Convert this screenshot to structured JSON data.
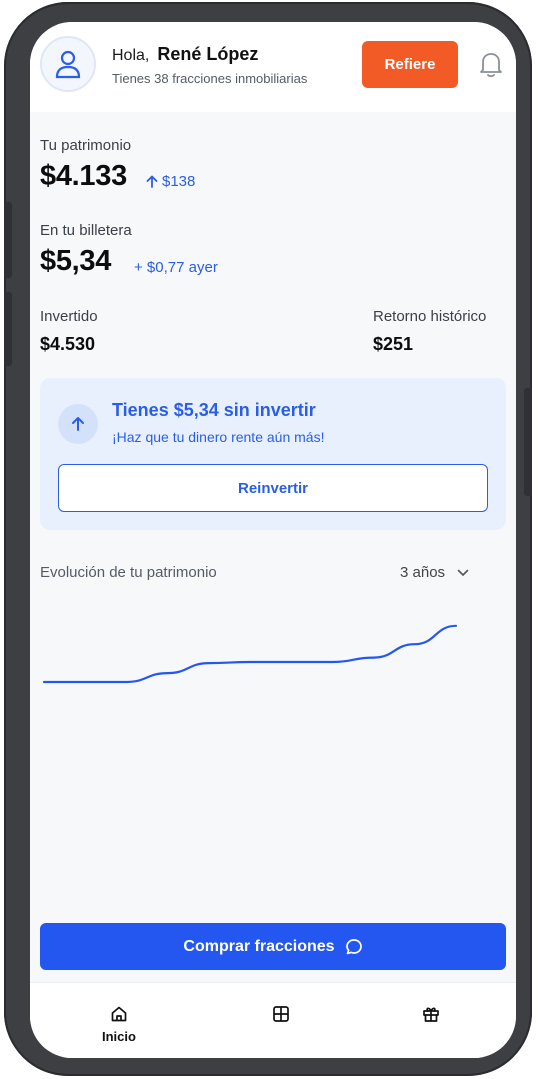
{
  "header": {
    "greeting": "Hola,",
    "user_name": "René López",
    "subtitle": "Tienes 38 fracciones inmobiliarias",
    "refer_label": "Refiere",
    "avatar_icon": "user-icon",
    "bell_icon": "bell-icon"
  },
  "portfolio": {
    "label": "Tu patrimonio",
    "value": "$4.133",
    "change": "$138",
    "change_icon": "arrow-up-icon"
  },
  "wallet": {
    "label": "En tu billetera",
    "value": "$5,34",
    "change": "+ $0,77 ayer"
  },
  "invested": {
    "label": "Invertido",
    "value": "$4.530"
  },
  "returns": {
    "label": "Retorno histórico",
    "value": "$251"
  },
  "reinvest_card": {
    "title": "Tienes $5,34 sin invertir",
    "subtitle": "¡Haz que tu dinero rente aún más!",
    "button_label": "Reinvertir",
    "icon": "arrow-up-icon"
  },
  "chart": {
    "title": "Evolución de tu patrimonio",
    "period": "3 años",
    "dropdown_icon": "chevron-down-icon"
  },
  "chart_data": {
    "type": "line",
    "title": "Evolución de tu patrimonio",
    "x": [
      0,
      1,
      2,
      3,
      4,
      5,
      6,
      7,
      8,
      9,
      10
    ],
    "series": [
      {
        "values": [
          3880,
          3880,
          3880,
          3920,
          3965,
          3970,
          3970,
          3970,
          3990,
          4050,
          4133
        ]
      }
    ],
    "ylim": [
      3700,
      4150
    ],
    "grid": false,
    "line_color": "#2357f0"
  },
  "buy_button": {
    "label": "Comprar fracciones",
    "icon": "chat-bubble-icon"
  },
  "bottom_nav": {
    "items": [
      {
        "label": "Inicio",
        "icon": "home-icon"
      },
      {
        "label": "",
        "icon": "grid-icon"
      },
      {
        "label": "",
        "icon": "gift-icon"
      }
    ]
  },
  "colors": {
    "accent": "#2357f0",
    "refer": "#f25a26",
    "card_bg": "#e9f0fd"
  }
}
